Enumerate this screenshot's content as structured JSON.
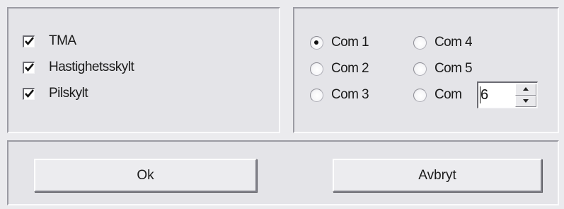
{
  "options": {
    "checkboxes": [
      {
        "label": "TMA",
        "checked": true
      },
      {
        "label": "Hastighetsskylt",
        "checked": true
      },
      {
        "label": "Pilskylt",
        "checked": true
      }
    ]
  },
  "ports": {
    "radios": [
      {
        "label": "Com 1",
        "selected": true
      },
      {
        "label": "Com 2",
        "selected": false
      },
      {
        "label": "Com 3",
        "selected": false
      },
      {
        "label": "Com 4",
        "selected": false
      },
      {
        "label": "Com 5",
        "selected": false
      },
      {
        "label": "Com",
        "selected": false
      }
    ],
    "custom_port_value": "6"
  },
  "buttons": {
    "ok_label": "Ok",
    "cancel_label": "Avbryt"
  }
}
